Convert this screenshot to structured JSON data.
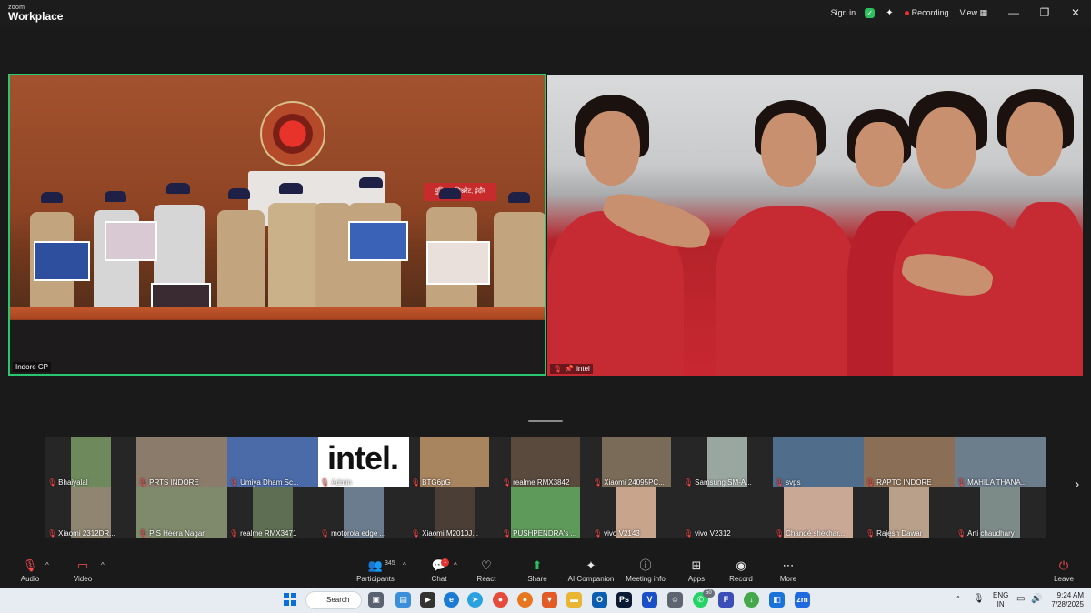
{
  "app": {
    "brand_top": "zoom",
    "brand_bottom": "Workplace",
    "sign_in": "Sign in",
    "recording": "Recording",
    "view": "View",
    "minimize": "—",
    "restore": "❐",
    "close": "✕"
  },
  "main_tiles": [
    {
      "name": "Indore CP"
    },
    {
      "name": "intel"
    }
  ],
  "main_text": {
    "placard_hindi": "पुलिस कमिश्नरेट, इंदौर"
  },
  "gallery": [
    {
      "name": "Bhaiyalal",
      "color": "#6e8a5d"
    },
    {
      "name": "PRTS  INDORE",
      "color": "#8a7b6a"
    },
    {
      "name": "Umiya Dham Sc...",
      "color": "#4b6aa8"
    },
    {
      "name": "Admin",
      "color": "#ffffff",
      "logo": "intel."
    },
    {
      "name": "BTG6pG",
      "color": "#a8845f"
    },
    {
      "name": "realme RMX3842",
      "color": "#5a4a3e"
    },
    {
      "name": "Xiaomi 24095PC...",
      "color": "#7a6a58"
    },
    {
      "name": "Samsung SM-A...",
      "color": "#9aa6a0"
    },
    {
      "name": "svps",
      "color": "#506e8c"
    },
    {
      "name": "RAPTC INDORE",
      "color": "#8a6e55"
    },
    {
      "name": "MAHILA THANA...",
      "color": "#6c7d8c"
    },
    {
      "name": "Xiaomi 2312DR...",
      "color": "#8f8570"
    },
    {
      "name": "P S Heera Nagar",
      "color": "#7e8a6b"
    },
    {
      "name": "realme RMX3471",
      "color": "#5e6e52"
    },
    {
      "name": "motorola edge ...",
      "color": "#6b7c8e"
    },
    {
      "name": "Xiaomi M2010J...",
      "color": "#4a3e36"
    },
    {
      "name": "PUSHPENDRA's ...",
      "color": "#5e9a5a"
    },
    {
      "name": "vivo V2143",
      "color": "#c7a48b"
    },
    {
      "name": "vivo V2312",
      "color": "#262626"
    },
    {
      "name": "Chandé shekhar...",
      "color": "#c9a896"
    },
    {
      "name": "Rajesh Dawar",
      "color": "#b9a08a"
    },
    {
      "name": "Arti chaudhary",
      "color": "#7d8b88"
    }
  ],
  "toolbar": {
    "audio": "Audio",
    "video": "Video",
    "participants": "Participants",
    "participants_count": "345",
    "chat": "Chat",
    "chat_badge": "1",
    "react": "React",
    "share": "Share",
    "ai_companion": "AI Companion",
    "meeting_info": "Meeting info",
    "apps": "Apps",
    "record": "Record",
    "more": "More",
    "leave": "Leave"
  },
  "taskbar": {
    "search": "Search",
    "lang_top": "ENG",
    "lang_bottom": "IN",
    "time": "9:24 AM",
    "date": "7/28/2025",
    "whatsapp_badge": "50"
  },
  "colors": {
    "active_speaker_border": "#28c76f",
    "recording_dot": "#e5322d",
    "share_green": "#2dbe60"
  }
}
